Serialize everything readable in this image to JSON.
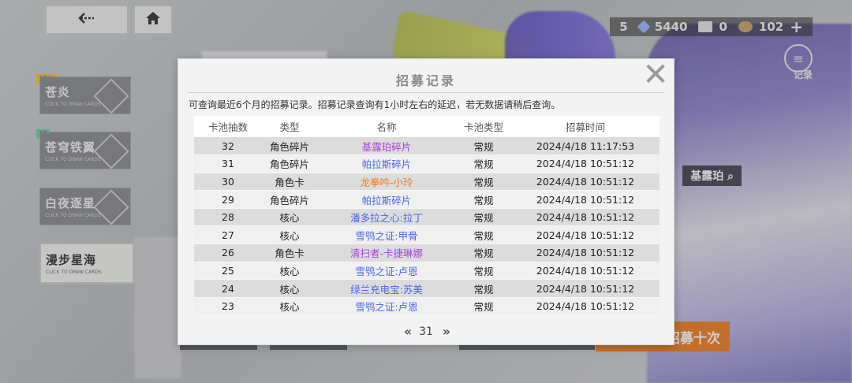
{
  "topbar": {
    "back_icon": "back-arrow-icon",
    "home_icon": "home-icon",
    "currencies": [
      {
        "name": "currency-a",
        "value": "5",
        "color": "#6fa8ff"
      },
      {
        "name": "currency-b",
        "value": "5440",
        "color": "#9fb4ff"
      },
      {
        "name": "currency-c",
        "value": "0",
        "color": "#e6e6e6"
      },
      {
        "name": "currency-d",
        "value": "102",
        "color": "#c9a46a"
      }
    ],
    "add_label": "+",
    "records_label": "记录"
  },
  "banners": [
    {
      "tag": "活动",
      "tag_color": "#f5c436",
      "name": "苍炎",
      "sub": "CLICK TO DRAW CARDS"
    },
    {
      "tag": "新",
      "tag_color": "#6fd39a",
      "name": "苍穹铁翼",
      "sub": "CLICK TO DRAW CARDS"
    },
    {
      "tag": "",
      "tag_color": "",
      "name": "白夜逐星",
      "sub": "CLICK TO DRAW CARDS"
    },
    {
      "tag": "",
      "tag_color": "",
      "name": "漫步星海",
      "sub": "CLICK TO DRAW CARDS"
    }
  ],
  "background": {
    "character_name": "基露珀",
    "draw_ten_label": "招募十次"
  },
  "modal": {
    "title": "招募记录",
    "close_icon": "close-icon",
    "notice": "可查询最近6个月的招募记录。招募记录查询有1小时左右的延迟，若无数据请稍后查询。",
    "columns": [
      "卡池抽数",
      "类型",
      "名称",
      "卡池类型",
      "招募时间"
    ],
    "rows": [
      {
        "count": "32",
        "type": "角色碎片",
        "name": "基露珀碎片",
        "rarity": "purple",
        "pool": "常规",
        "time": "2024/4/18 11:17:53"
      },
      {
        "count": "31",
        "type": "角色碎片",
        "name": "帕拉斯碎片",
        "rarity": "blue",
        "pool": "常规",
        "time": "2024/4/18 10:51:12"
      },
      {
        "count": "30",
        "type": "角色卡",
        "name": "龙拳吟-小玲",
        "rarity": "orange",
        "pool": "常规",
        "time": "2024/4/18 10:51:12"
      },
      {
        "count": "29",
        "type": "角色碎片",
        "name": "帕拉斯碎片",
        "rarity": "blue",
        "pool": "常规",
        "time": "2024/4/18 10:51:12"
      },
      {
        "count": "28",
        "type": "核心",
        "name": "潘多拉之心:拉丁",
        "rarity": "blue",
        "pool": "常规",
        "time": "2024/4/18 10:51:12"
      },
      {
        "count": "27",
        "type": "核心",
        "name": "雪鸮之证:甲骨",
        "rarity": "blue",
        "pool": "常规",
        "time": "2024/4/18 10:51:12"
      },
      {
        "count": "26",
        "type": "角色卡",
        "name": "清扫者-卡捷琳娜",
        "rarity": "purple",
        "pool": "常规",
        "time": "2024/4/18 10:51:12"
      },
      {
        "count": "25",
        "type": "核心",
        "name": "雪鸮之证:卢恩",
        "rarity": "blue",
        "pool": "常规",
        "time": "2024/4/18 10:51:12"
      },
      {
        "count": "24",
        "type": "核心",
        "name": "绿兰充电宝:苏美",
        "rarity": "blue",
        "pool": "常规",
        "time": "2024/4/18 10:51:12"
      },
      {
        "count": "23",
        "type": "核心",
        "name": "雪鸮之证:卢恩",
        "rarity": "blue",
        "pool": "常规",
        "time": "2024/4/18 10:51:12"
      }
    ],
    "pager": {
      "prev_label": "‹‹",
      "page": "31",
      "next_label": "››"
    }
  }
}
